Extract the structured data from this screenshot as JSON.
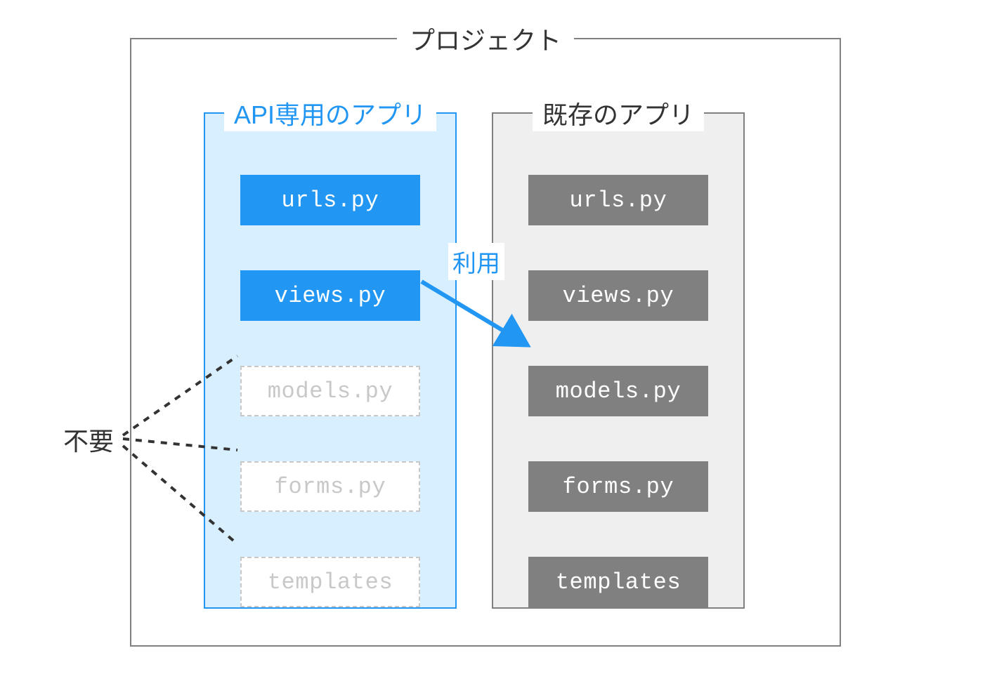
{
  "project": {
    "title": "プロジェクト"
  },
  "apiApp": {
    "title": "API専用のアプリ",
    "files": {
      "urls": "urls.py",
      "views": "views.py",
      "models": "models.py",
      "forms": "forms.py",
      "templates": "templates"
    }
  },
  "existingApp": {
    "title": "既存のアプリ",
    "files": {
      "urls": "urls.py",
      "views": "views.py",
      "models": "models.py",
      "forms": "forms.py",
      "templates": "templates"
    }
  },
  "labels": {
    "unused": "不要",
    "usage": "利用"
  }
}
